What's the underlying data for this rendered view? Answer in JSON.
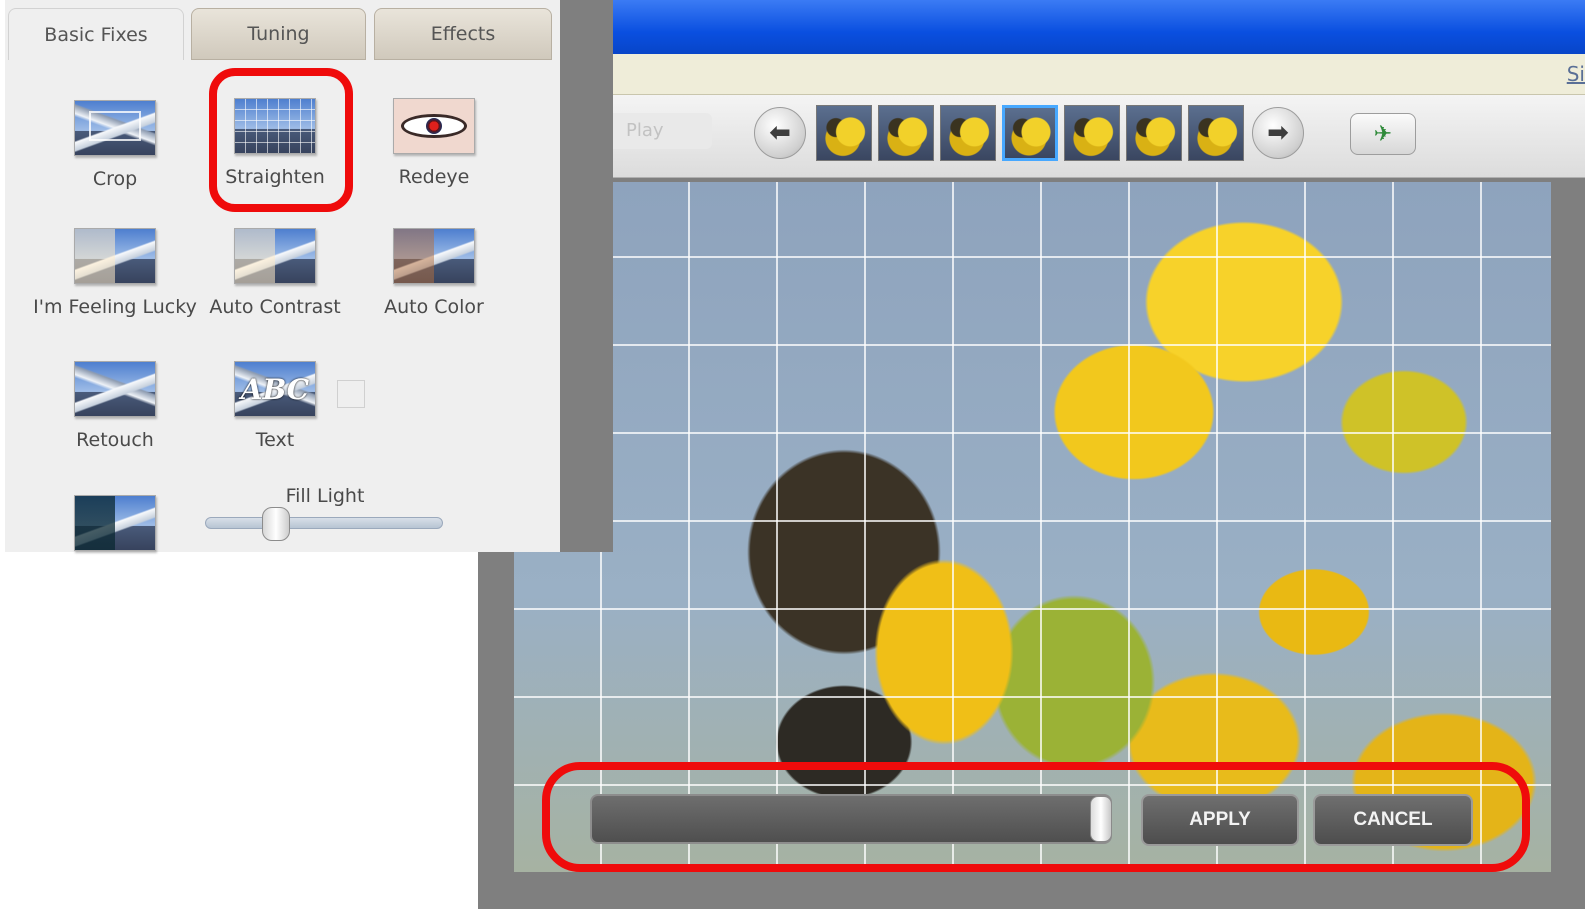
{
  "panel": {
    "tabs": [
      "Basic Fixes",
      "Tuning",
      "Effects"
    ],
    "tools": {
      "crop": "Crop",
      "straighten": "Straighten",
      "redeye": "Redeye",
      "feeling_lucky": "I'm Feeling Lucky",
      "auto_contrast": "Auto Contrast",
      "auto_color": "Auto Color",
      "retouch": "Retouch",
      "text": "Text",
      "text_icon": "ABC"
    },
    "fill_light": {
      "label": "Fill Light",
      "value": 0.3
    }
  },
  "toolbar": {
    "play_label": "Play",
    "menu_right_text": "Si",
    "thumbnail_count": 7,
    "selected_thumbnail_index": 3
  },
  "straighten": {
    "apply_label": "APPLY",
    "cancel_label": "CANCEL",
    "slider_value": 0.98
  },
  "annotations": {
    "highlight_color": "#ef0b0b"
  },
  "colors": {
    "titlebar": "#0a4fe0",
    "selected_thumb_border": "#47a8ff"
  }
}
